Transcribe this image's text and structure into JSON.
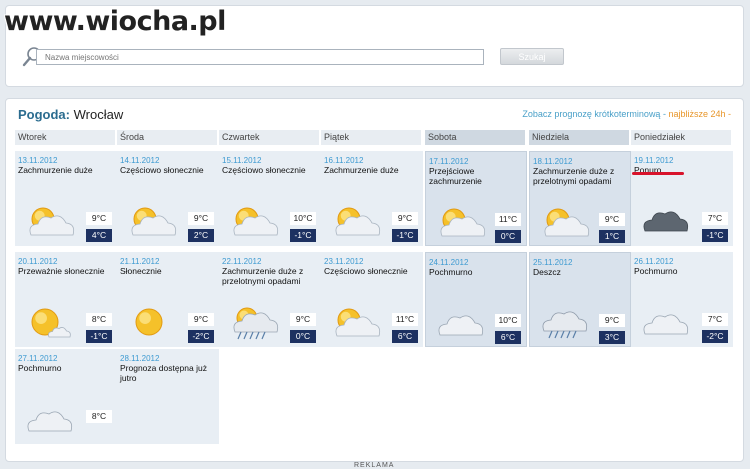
{
  "watermark": "www.wiocha.pl",
  "search": {
    "placeholder": "Nazwa miejscowości",
    "button_label": "Szukaj"
  },
  "header": {
    "label": "Pogoda:",
    "city": "Wrocław",
    "link_text": "Zobacz prognozę krótkoterminową - ",
    "link_highlight": "najbliższe 24h -"
  },
  "days": [
    "Wtorek",
    "Środa",
    "Czwartek",
    "Piątek",
    "Sobota",
    "Niedziela",
    "Poniedziałek"
  ],
  "forecast": [
    {
      "date": "13.11.2012",
      "desc": "Zachmurzenie duże",
      "max": "9°C",
      "min": "4°C",
      "icon": "sun-cloud"
    },
    {
      "date": "14.11.2012",
      "desc": "Częściowo słonecznie",
      "max": "9°C",
      "min": "2°C",
      "icon": "sun-cloud"
    },
    {
      "date": "15.11.2012",
      "desc": "Częściowo słonecznie",
      "max": "10°C",
      "min": "-1°C",
      "icon": "sun-cloud"
    },
    {
      "date": "16.11.2012",
      "desc": "Zachmurzenie duże",
      "max": "9°C",
      "min": "-1°C",
      "icon": "sun-cloud"
    },
    {
      "date": "17.11.2012",
      "desc": "Przejściowe zachmurzenie",
      "max": "11°C",
      "min": "0°C",
      "icon": "sun-cloud"
    },
    {
      "date": "18.11.2012",
      "desc": "Zachmurzenie duże z przelotnymi opadami",
      "max": "9°C",
      "min": "1°C",
      "icon": "sun-cloud"
    },
    {
      "date": "19.11.2012",
      "desc": "Ponuro",
      "max": "7°C",
      "min": "-1°C",
      "icon": "dark-cloud"
    },
    {
      "date": "20.11.2012",
      "desc": "Przeważnie słonecznie",
      "max": "8°C",
      "min": "-1°C",
      "icon": "sun-small-cloud"
    },
    {
      "date": "21.11.2012",
      "desc": "Słonecznie",
      "max": "9°C",
      "min": "-2°C",
      "icon": "sun"
    },
    {
      "date": "22.11.2012",
      "desc": "Zachmurzenie duże z przelotnymi opadami",
      "max": "9°C",
      "min": "0°C",
      "icon": "sun-cloud-rain"
    },
    {
      "date": "23.11.2012",
      "desc": "Częściowo słonecznie",
      "max": "11°C",
      "min": "6°C",
      "icon": "sun-cloud"
    },
    {
      "date": "24.11.2012",
      "desc": "Pochmurno",
      "max": "10°C",
      "min": "6°C",
      "icon": "cloud"
    },
    {
      "date": "25.11.2012",
      "desc": "Deszcz",
      "max": "9°C",
      "min": "3°C",
      "icon": "rain-cloud"
    },
    {
      "date": "26.11.2012",
      "desc": "Pochmurno",
      "max": "7°C",
      "min": "-2°C",
      "icon": "cloud"
    },
    {
      "date": "27.11.2012",
      "desc": "Pochmurno",
      "max": "8°C",
      "min": "",
      "icon": "cloud"
    },
    {
      "date": "28.11.2012",
      "desc": "Prognoza dostępna już jutro",
      "max": "",
      "min": "",
      "icon": ""
    }
  ],
  "ad_label": "REKLAMA",
  "colors": {
    "accent_blue": "#3d9ad1",
    "min_temp_bg": "#1d3161",
    "highlight_orange": "#e8962a",
    "underline_red": "#d8132b"
  }
}
